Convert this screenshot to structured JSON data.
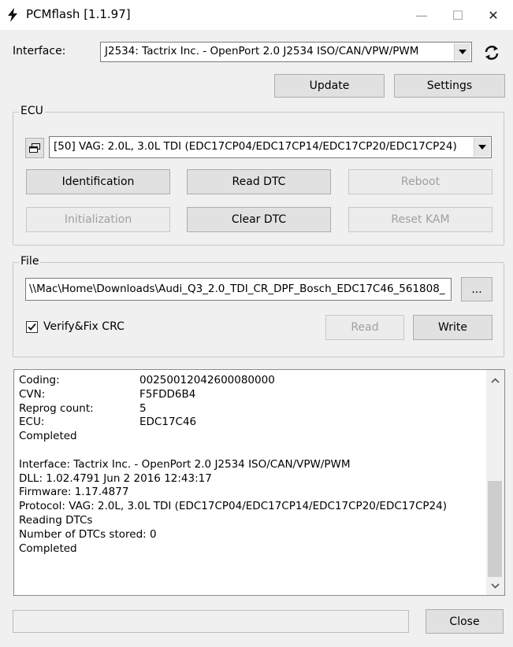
{
  "window": {
    "title": "PCMflash [1.1.97]",
    "minimize_glyph": "—",
    "maximize_glyph": "☐",
    "close_glyph": "✕"
  },
  "interface": {
    "label": "Interface:",
    "selected": "J2534: Tactrix Inc. - OpenPort 2.0 J2534 ISO/CAN/VPW/PWM",
    "refresh_icon": "refresh-icon",
    "update_label": "Update",
    "settings_label": "Settings"
  },
  "ecu": {
    "legend": "ECU",
    "selected": "[50] VAG: 2.0L, 3.0L TDI (EDC17CP04/EDC17CP14/EDC17CP20/EDC17CP24)",
    "buttons": {
      "identification": "Identification",
      "read_dtc": "Read DTC",
      "reboot": "Reboot",
      "initialization": "Initialization",
      "clear_dtc": "Clear DTC",
      "reset_kam": "Reset KAM"
    }
  },
  "file": {
    "legend": "File",
    "path": "\\\\Mac\\Home\\Downloads\\Audi_Q3_2.0_TDI_CR_DPF_Bosch_EDC17C46_561808_",
    "browse_label": "...",
    "verify_label": "Verify&Fix CRC",
    "verify_checked": true,
    "read_label": "Read",
    "write_label": "Write"
  },
  "log": {
    "lines": [
      {
        "k": "Coding:",
        "v": "00250012042600080000"
      },
      {
        "k": "CVN:",
        "v": "F5FDD6B4"
      },
      {
        "k": "Reprog count:",
        "v": "5"
      },
      {
        "k": "ECU:",
        "v": "EDC17C46"
      },
      {
        "k": "Completed",
        "v": ""
      },
      {
        "k": "",
        "v": ""
      },
      {
        "k": "Interface: Tactrix Inc. - OpenPort 2.0 J2534 ISO/CAN/VPW/PWM",
        "v": ""
      },
      {
        "k": "DLL: 1.02.4791 Jun  2 2016 12:43:17",
        "v": ""
      },
      {
        "k": "Firmware: 1.17.4877",
        "v": ""
      },
      {
        "k": "Protocol: VAG: 2.0L, 3.0L TDI (EDC17CP04/EDC17CP14/EDC17CP20/EDC17CP24)",
        "v": ""
      },
      {
        "k": "Reading DTCs",
        "v": ""
      },
      {
        "k": "Number of DTCs stored: 0",
        "v": ""
      },
      {
        "k": "Completed",
        "v": ""
      }
    ]
  },
  "footer": {
    "status": "",
    "close_label": "Close"
  }
}
